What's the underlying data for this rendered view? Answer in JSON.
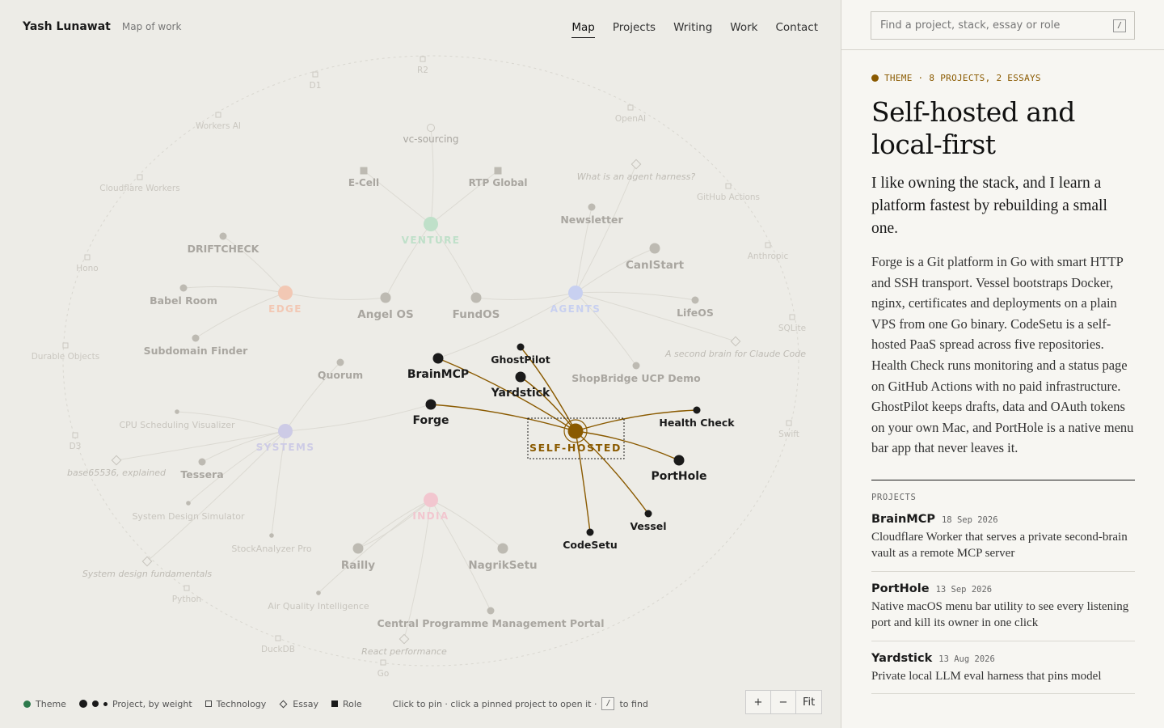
{
  "header": {
    "brand_name": "Yash Lunawat",
    "brand_sub": "Map of work",
    "nav": [
      {
        "label": "Map",
        "active": true
      },
      {
        "label": "Projects",
        "active": false
      },
      {
        "label": "Writing",
        "active": false
      },
      {
        "label": "Work",
        "active": false
      },
      {
        "label": "Contact",
        "active": false
      }
    ]
  },
  "colors": {
    "accent": "#8a5a00",
    "theme_green": "#2d7a4c",
    "edge_faded": "#f2c8b4",
    "venture_faded": "#bfe0c9",
    "agents_faded": "#c8d0f0",
    "systems_faded": "#cdcbe6",
    "india_faded": "#f2c6cf",
    "ink": "#1a1a1a"
  },
  "graph": {
    "themes": [
      {
        "id": "venture",
        "label": "VENTURE",
        "color": "#bfe0c9"
      },
      {
        "id": "edge",
        "label": "EDGE",
        "color": "#f2c8b4"
      },
      {
        "id": "agents",
        "label": "AGENTS",
        "color": "#c8d0f0"
      },
      {
        "id": "systems",
        "label": "SYSTEMS",
        "color": "#cdcbe6"
      },
      {
        "id": "india",
        "label": "INDIA",
        "color": "#f2c6cf"
      },
      {
        "id": "selfhosted",
        "label": "SELF-HOSTED",
        "color": "#8a5a00",
        "selected": true
      }
    ],
    "projects": [
      {
        "label": "BrainMCP",
        "weight": 3,
        "active": true,
        "theme": "selfhosted"
      },
      {
        "label": "GhostPilot",
        "weight": 1,
        "active": true,
        "theme": "selfhosted"
      },
      {
        "label": "Yardstick",
        "weight": 3,
        "active": true,
        "theme": "selfhosted"
      },
      {
        "label": "Forge",
        "weight": 3,
        "active": true,
        "theme": "selfhosted"
      },
      {
        "label": "Health Check",
        "weight": 1,
        "active": true,
        "theme": "selfhosted"
      },
      {
        "label": "PortHole",
        "weight": 3,
        "active": true,
        "theme": "selfhosted"
      },
      {
        "label": "Vessel",
        "weight": 1,
        "active": true,
        "theme": "selfhosted"
      },
      {
        "label": "CodeSetu",
        "weight": 1,
        "active": true,
        "theme": "selfhosted"
      },
      {
        "label": "DRIFTCHECK",
        "weight": 1,
        "theme": "edge"
      },
      {
        "label": "Babel Room",
        "weight": 1,
        "theme": "edge"
      },
      {
        "label": "Subdomain Finder",
        "weight": 1,
        "theme": "edge"
      },
      {
        "label": "Angel OS",
        "weight": 2,
        "theme": "venture"
      },
      {
        "label": "FundOS",
        "weight": 2,
        "theme": "venture"
      },
      {
        "label": "Newsletter",
        "weight": 1,
        "theme": "agents"
      },
      {
        "label": "CanIStart",
        "weight": 2,
        "theme": "agents"
      },
      {
        "label": "LifeOS",
        "weight": 1,
        "theme": "agents"
      },
      {
        "label": "ShopBridge UCP Demo",
        "weight": 1,
        "theme": "agents"
      },
      {
        "label": "Quorum",
        "weight": 1,
        "theme": "systems"
      },
      {
        "label": "CPU Scheduling Visualizer",
        "weight": 0,
        "theme": "systems"
      },
      {
        "label": "Tessera",
        "weight": 1,
        "theme": "systems"
      },
      {
        "label": "System Design Simulator",
        "weight": 0,
        "theme": "systems"
      },
      {
        "label": "StockAnalyzer Pro",
        "weight": 0,
        "theme": "systems"
      },
      {
        "label": "Railly",
        "weight": 2,
        "theme": "india"
      },
      {
        "label": "NagrikSetu",
        "weight": 2,
        "theme": "india"
      },
      {
        "label": "Air Quality Intelligence",
        "weight": 0,
        "theme": "india"
      },
      {
        "label": "Central Programme Management Portal",
        "weight": 1,
        "theme": "india"
      }
    ],
    "roles": [
      {
        "label": "E-Cell"
      },
      {
        "label": "RTP Global"
      }
    ],
    "essays": [
      {
        "label": "What is an agent harness?"
      },
      {
        "label": "A second brain for Claude Code"
      },
      {
        "label": "base65536, explained"
      },
      {
        "label": "System design fundamentals"
      },
      {
        "label": "React performance"
      },
      {
        "label": "vc-sourcing"
      }
    ],
    "technologies": [
      {
        "label": "R2"
      },
      {
        "label": "D1"
      },
      {
        "label": "OpenAI"
      },
      {
        "label": "Workers AI"
      },
      {
        "label": "GitHub Actions"
      },
      {
        "label": "Cloudflare Workers"
      },
      {
        "label": "Anthropic"
      },
      {
        "label": "Hono"
      },
      {
        "label": "SQLite"
      },
      {
        "label": "Durable Objects"
      },
      {
        "label": "Swift"
      },
      {
        "label": "D3"
      },
      {
        "label": "Python"
      },
      {
        "label": "DuckDB"
      },
      {
        "label": "Go"
      }
    ]
  },
  "legend": {
    "theme": "Theme",
    "project": "Project, by weight",
    "technology": "Technology",
    "essay": "Essay",
    "role": "Role",
    "hint_before": "Click to pin · click a pinned project to open it ·",
    "hint_key": "/",
    "hint_after": "to find"
  },
  "zoom": {
    "in": "+",
    "out": "−",
    "fit": "Fit"
  },
  "sidebar": {
    "search_placeholder": "Find a project, stack, essay or role",
    "search_key": "/",
    "eyebrow": "THEME · 8 PROJECTS, 2 ESSAYS",
    "title": "Self-hosted and local-first",
    "lede": "I like owning the stack, and I learn a platform fastest by rebuilding a small one.",
    "body": "Forge is a Git platform in Go with smart HTTP and SSH transport. Vessel bootstraps Docker, nginx, certificates and deployments on a plain VPS from one Go binary. CodeSetu is a self-hosted PaaS spread across five repositories. Health Check runs monitoring and a status page on GitHub Actions with no paid infrastructure. GhostPilot keeps drafts, data and OAuth tokens on your own Mac, and PortHole is a native menu bar app that never leaves it.",
    "projects_heading": "PROJECTS",
    "projects": [
      {
        "name": "BrainMCP",
        "date": "18 Sep 2026",
        "desc": "Cloudflare Worker that serves a private second-brain vault as a remote MCP server"
      },
      {
        "name": "PortHole",
        "date": "13 Sep 2026",
        "desc": "Native macOS menu bar utility to see every listening port and kill its owner in one click"
      },
      {
        "name": "Yardstick",
        "date": "13 Aug 2026",
        "desc": "Private local LLM eval harness that pins model"
      }
    ]
  }
}
